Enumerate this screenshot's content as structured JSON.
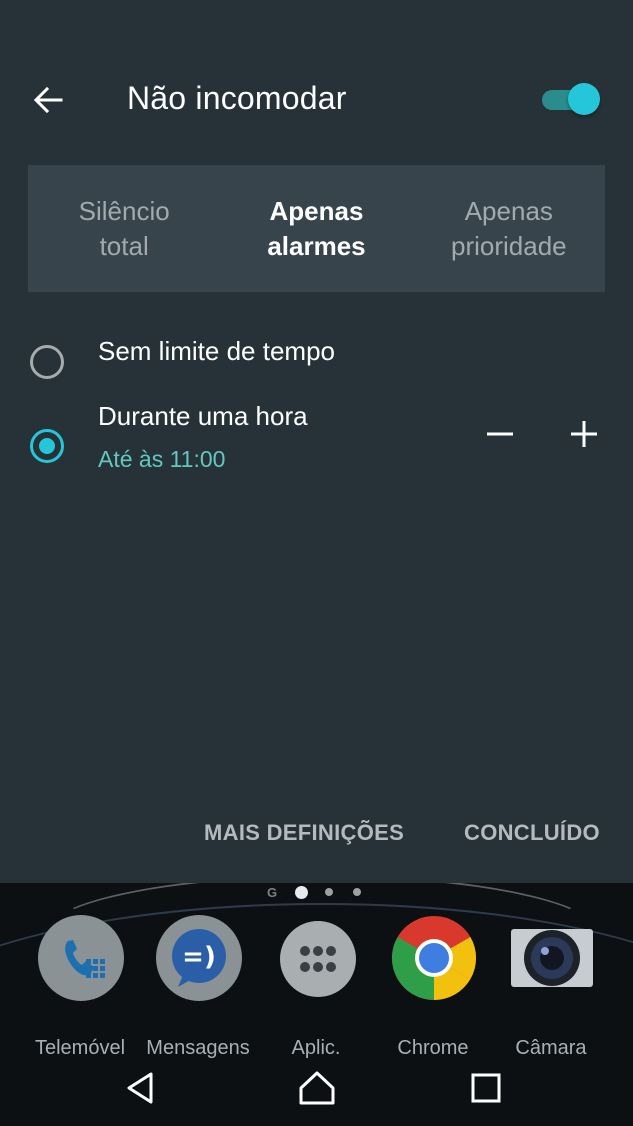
{
  "header": {
    "title": "Não incomodar",
    "back_icon": "arrow-left-icon",
    "toggle_on": true
  },
  "tabs": [
    {
      "label": "Silêncio\ntotal",
      "active": false
    },
    {
      "label": "Apenas\nalarmes",
      "active": true
    },
    {
      "label": "Apenas\nprioridade",
      "active": false
    }
  ],
  "options": {
    "no_limit": {
      "label": "Sem limite de tempo",
      "selected": false
    },
    "one_hour": {
      "label": "Durante uma hora",
      "sub": "Até às 11:00",
      "selected": true
    }
  },
  "actions": {
    "more_settings": "MAIS DEFINIÇÕES",
    "done": "CONCLUÍDO"
  },
  "home": {
    "pager_g": "G",
    "apps": [
      {
        "label": "Telemóvel",
        "icon": "phone-icon"
      },
      {
        "label": "Mensagens",
        "icon": "messages-icon"
      },
      {
        "label": "Aplic.",
        "icon": "apps-grid-icon"
      },
      {
        "label": "Chrome",
        "icon": "chrome-icon"
      },
      {
        "label": "Câmara",
        "icon": "camera-icon"
      }
    ]
  },
  "colors": {
    "accent": "#26c6da",
    "panel": "#263238",
    "tab_bg": "#37444b",
    "subtext": "#64c6c1"
  }
}
